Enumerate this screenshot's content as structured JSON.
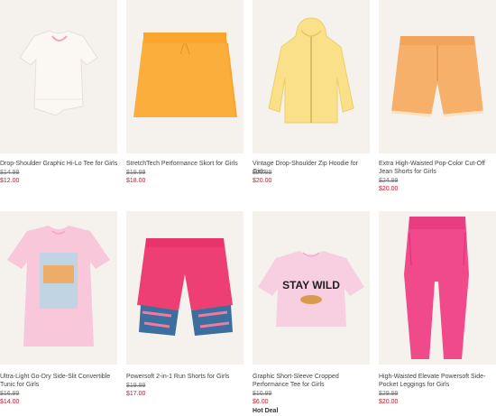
{
  "products": [
    {
      "name": "Drop-Shoulder Graphic Hi-Lo Tee for Girls",
      "was": "$14.99",
      "now": "$12.00",
      "image": "white-tee-icon"
    },
    {
      "name": "StretchTech Performance Skort for Girls",
      "was": "$19.99",
      "now": "$18.00",
      "image": "orange-skort-icon"
    },
    {
      "name": "Vintage Drop-Shoulder Zip Hoodie for Girls",
      "was": "$26.99",
      "now": "$20.00",
      "image": "yellow-hoodie-icon"
    },
    {
      "name": "Extra High-Waisted Pop-Color Cut-Off Jean Shorts for Girls",
      "was": "$24.99",
      "now": "$20.00",
      "image": "orange-jean-shorts-icon"
    },
    {
      "name": "Ultra-Light Go-Dry Side-Slit Convertible Tunic for Girls",
      "was": "$16.99",
      "now": "$14.00",
      "image": "pink-tunic-icon"
    },
    {
      "name": "Powersoft 2-in-1 Run Shorts for Girls",
      "was": "$19.99",
      "now": "$17.00",
      "image": "pink-run-shorts-icon"
    },
    {
      "name": "Graphic Short-Sleeve Cropped Performance Tee for Girls",
      "was": "$10.99",
      "now": "$6.00",
      "badge": "Hot Deal",
      "image": "pink-cropped-tee-icon",
      "graphic_text": "STAY WILD"
    },
    {
      "name": "High-Waisted Elevate Powersoft Side-Pocket Leggings for Girls",
      "was": "$29.99",
      "now": "$20.00",
      "image": "pink-leggings-icon"
    }
  ],
  "colors": {
    "sale_price": "#b1232e",
    "image_bg": "#f5f2ee",
    "text": "#444444"
  }
}
